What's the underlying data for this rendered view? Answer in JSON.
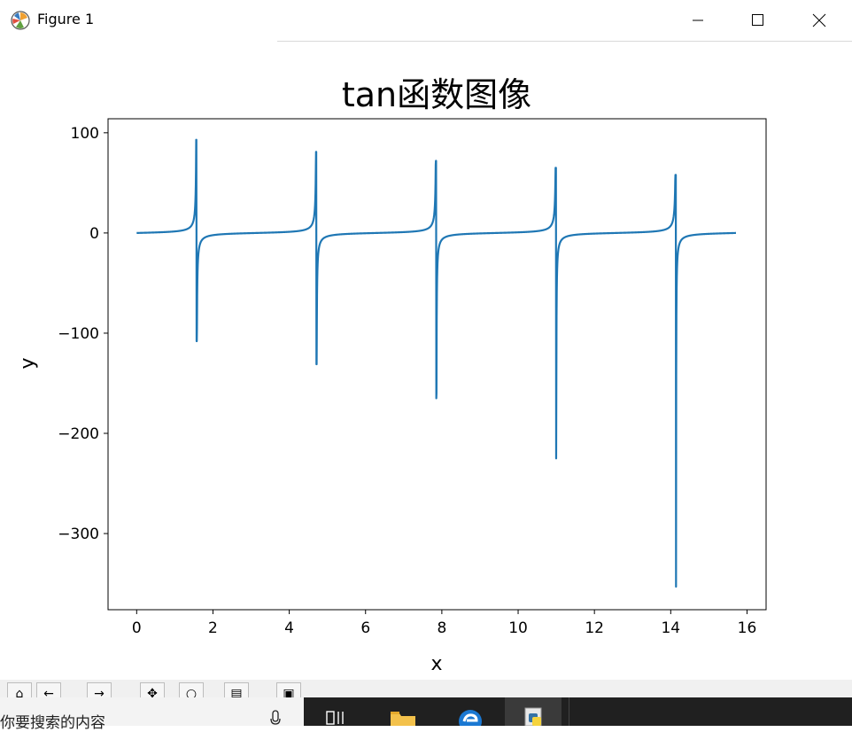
{
  "window": {
    "title": "Figure 1",
    "icons": [
      "matplotlib-logo-icon",
      "minimize-icon",
      "maximize-icon",
      "close-icon"
    ]
  },
  "toolbar": {
    "buttons": [
      {
        "name": "home-button",
        "icon": "home-icon"
      },
      {
        "name": "back-button",
        "icon": "back-arrow-icon"
      },
      {
        "name": "forward-button",
        "icon": "forward-arrow-icon"
      },
      {
        "name": "pan-button",
        "icon": "pan-icon"
      },
      {
        "name": "zoom-button",
        "icon": "zoom-icon"
      },
      {
        "name": "subplots-button",
        "icon": "subplots-icon"
      },
      {
        "name": "save-button",
        "icon": "save-icon"
      }
    ]
  },
  "taskbar": {
    "search_placeholder": "你要搜索的内容",
    "icons": [
      "microphone-icon",
      "task-view-icon",
      "file-explorer-icon",
      "edge-browser-icon",
      "python-app-icon"
    ]
  },
  "chart_data": {
    "type": "line",
    "title": "tan函数图像",
    "xlabel": "x",
    "ylabel": "y",
    "xlim": [
      -0.75,
      16.5
    ],
    "ylim": [
      -376,
      114
    ],
    "xticks": [
      "0",
      "2",
      "4",
      "6",
      "8",
      "10",
      "12",
      "14",
      "16"
    ],
    "yticks": [
      "100",
      "0",
      "−100",
      "−200",
      "−300"
    ],
    "grid": false,
    "series_color": "#1f77b4",
    "function": "tan(x)",
    "x_range": [
      0,
      15.71
    ],
    "extrema": [
      {
        "x": 1.57,
        "max": 93,
        "min": -108
      },
      {
        "x": 4.71,
        "max": 81,
        "min": -131
      },
      {
        "x": 7.85,
        "max": 72,
        "min": -165
      },
      {
        "x": 10.99,
        "max": 65,
        "min": -225
      },
      {
        "x": 14.13,
        "max": 58,
        "min": -353
      }
    ]
  }
}
